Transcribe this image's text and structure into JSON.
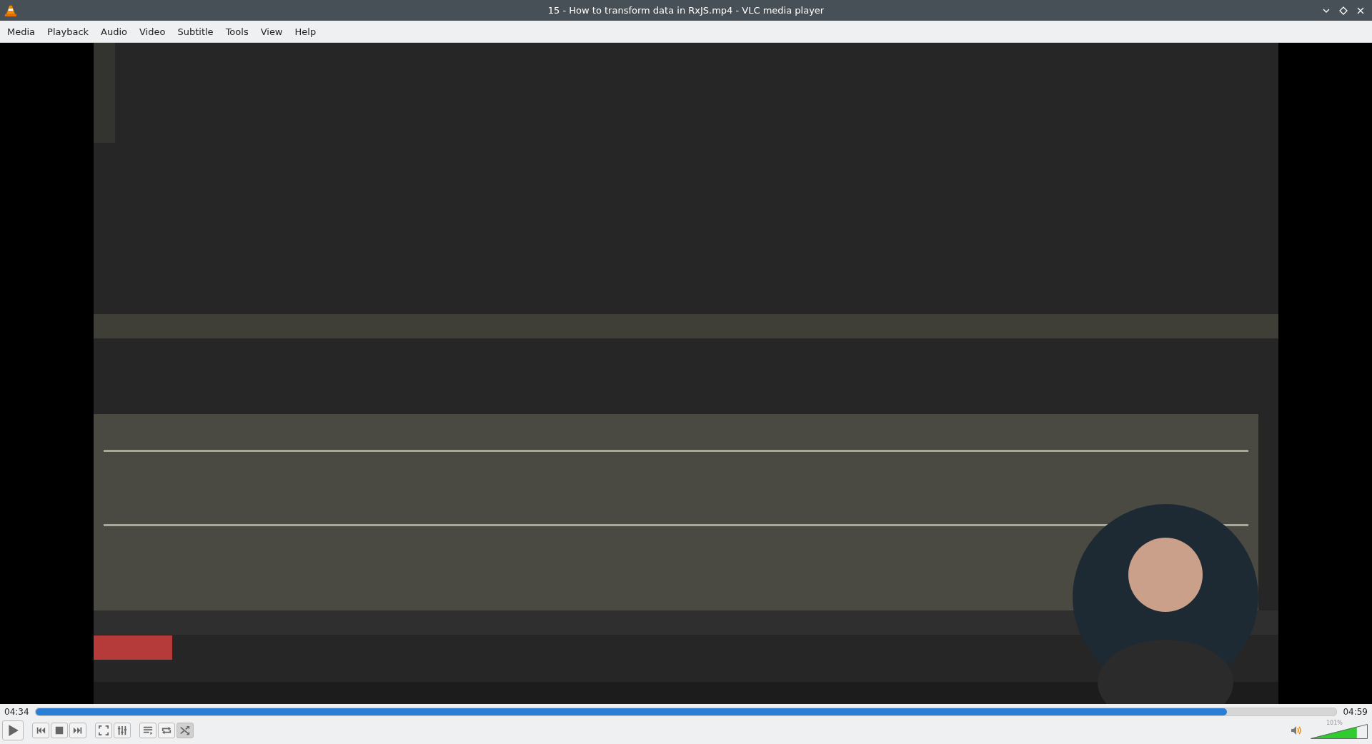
{
  "window": {
    "title": "15 - How to transform data in RxJS.mp4 - VLC media player"
  },
  "menu": [
    "Media",
    "Playback",
    "Audio",
    "Video",
    "Subtitle",
    "Tools",
    "View",
    "Help"
  ],
  "video": {
    "kind": "picture"
  },
  "progress": {
    "elapsed": "04:34",
    "level": 0.916,
    "total": "04:59"
  },
  "controls": [
    [
      {
        "kind": "play"
      }
    ],
    [
      {
        "kind": "previous"
      },
      {
        "kind": "stop"
      },
      {
        "kind": "next"
      }
    ],
    [
      {
        "kind": "fullscreen"
      },
      {
        "kind": "settings"
      }
    ],
    [
      {
        "kind": "playlist",
        "on": false
      },
      {
        "kind": "loop",
        "on": false
      },
      {
        "kind": "random",
        "on": true
      }
    ]
  ],
  "volume": {
    "reading": "101%",
    "level": 0.81
  }
}
